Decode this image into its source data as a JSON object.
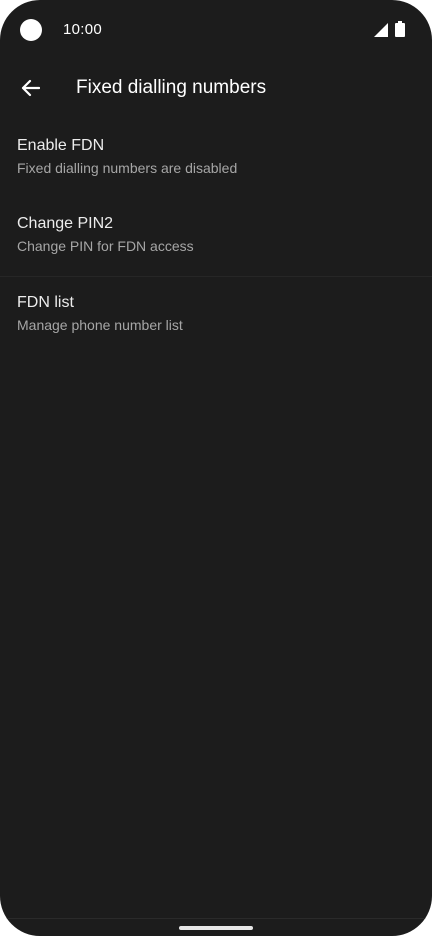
{
  "status_bar": {
    "time": "10:00",
    "icons": [
      "camera-dot-icon",
      "cell-signal-icon",
      "battery-icon"
    ]
  },
  "app_bar": {
    "back_icon": "arrow-back-icon",
    "title": "Fixed dialling numbers"
  },
  "preferences": [
    {
      "title": "Enable FDN",
      "summary": "Fixed dialling numbers are disabled"
    },
    {
      "title": "Change PIN2",
      "summary": "Change PIN for FDN access"
    },
    {
      "title": "FDN list",
      "summary": "Manage phone number list"
    }
  ],
  "colors": {
    "background": "#1c1c1c",
    "title_text": "#ffffff",
    "item_title": "#ececec",
    "item_summary": "#a6a6a6"
  }
}
